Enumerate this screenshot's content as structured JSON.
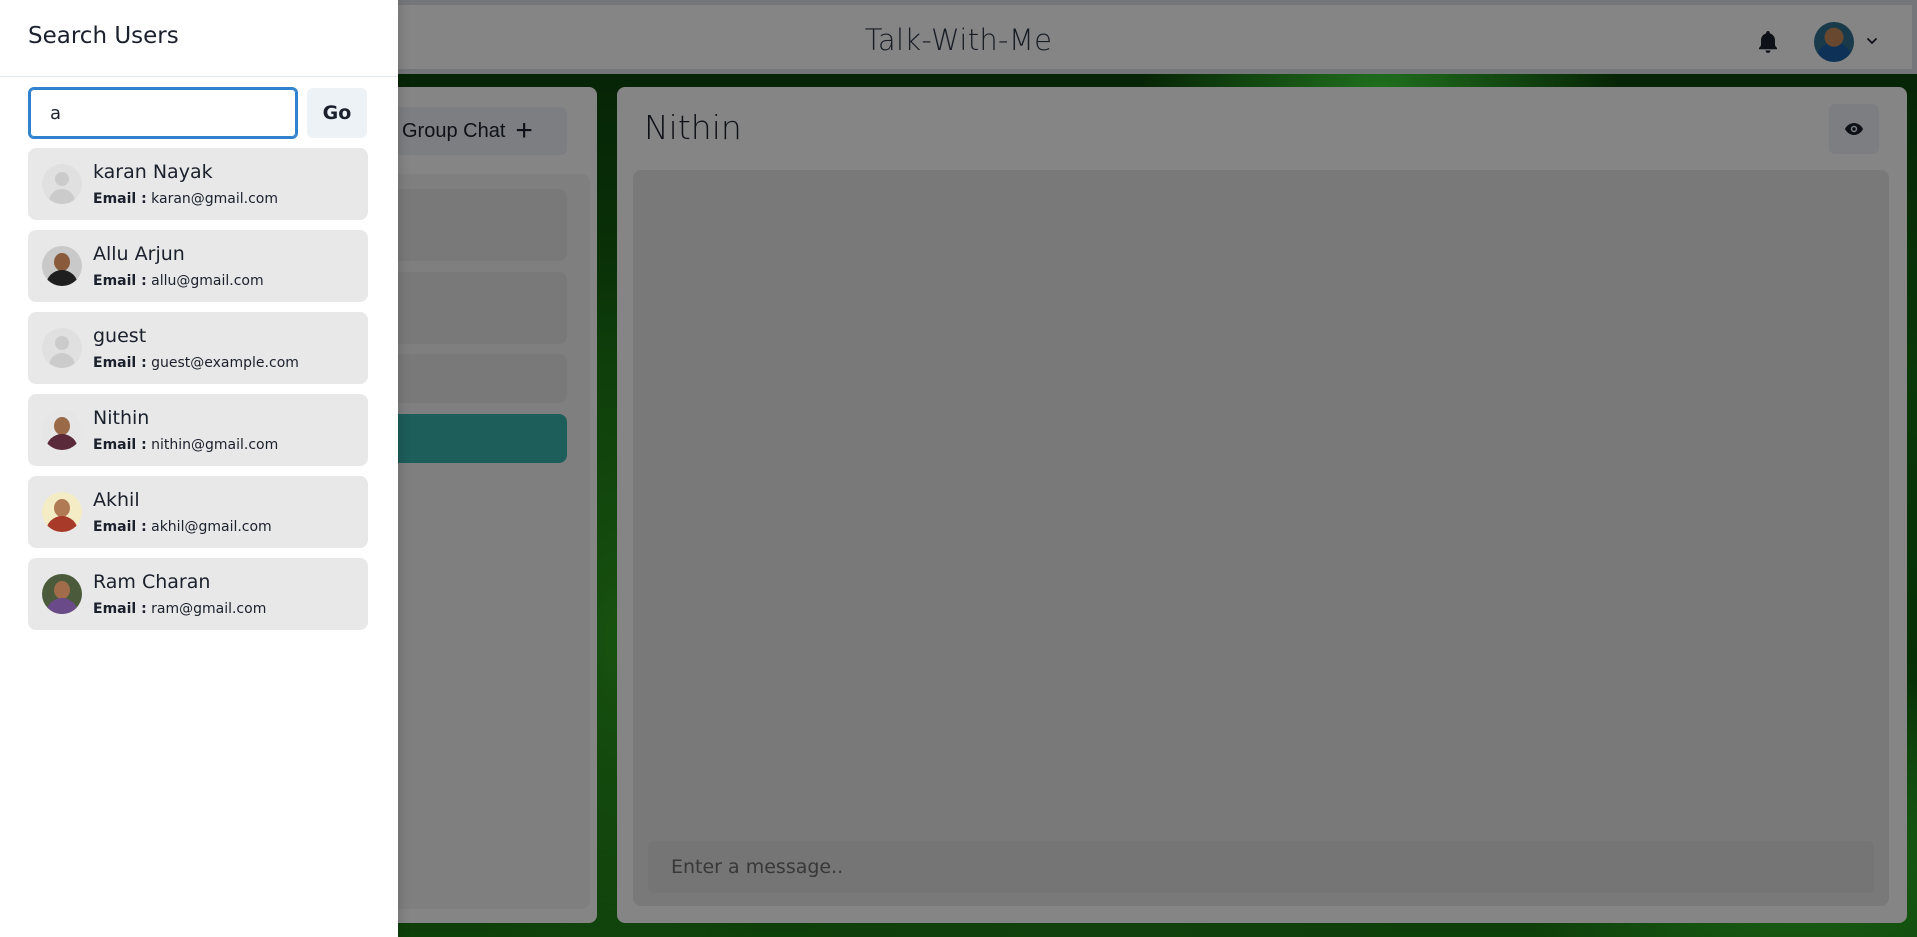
{
  "app": {
    "title": "Talk-With-Me"
  },
  "header": {
    "notification_icon": "bell-icon",
    "profile_menu_icon": "chevron-down-icon"
  },
  "chats": {
    "new_group_label": "Group Chat",
    "new_group_icon": "plus-icon"
  },
  "main": {
    "chat_name": "Nithin",
    "view_profile_icon": "eye-icon",
    "message_placeholder": "Enter a message.."
  },
  "drawer": {
    "title": "Search Users",
    "search_value": "a",
    "go_label": "Go",
    "email_label": "Email :",
    "users": [
      {
        "name": "karan Nayak",
        "email": "karan@gmail.com",
        "avatar": "placeholder"
      },
      {
        "name": "Allu Arjun",
        "email": "allu@gmail.com",
        "avatar": "photo"
      },
      {
        "name": "guest",
        "email": "guest@example.com",
        "avatar": "placeholder"
      },
      {
        "name": "Nithin",
        "email": "nithin@gmail.com",
        "avatar": "photo"
      },
      {
        "name": "Akhil",
        "email": "akhil@gmail.com",
        "avatar": "photo"
      },
      {
        "name": "Ram Charan",
        "email": "ram@gmail.com",
        "avatar": "photo"
      }
    ]
  },
  "colors": {
    "accent": "#3182ce",
    "active_chat": "#38b2ac",
    "overlay": "rgba(0,0,0,0.48)"
  }
}
